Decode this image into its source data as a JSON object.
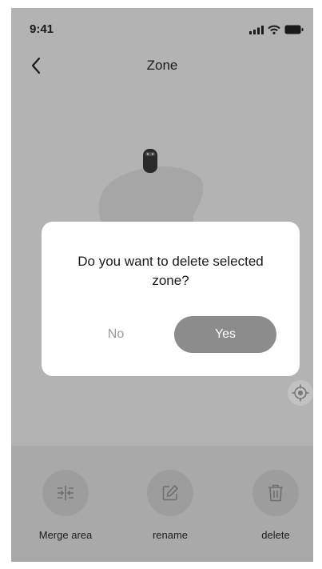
{
  "status_bar": {
    "time": "9:41",
    "icons": [
      "signal-icon",
      "wifi-icon",
      "battery-icon"
    ]
  },
  "header": {
    "back_icon": "chevron-left-icon",
    "title": "Zone"
  },
  "map": {
    "locate_icon": "locate-icon"
  },
  "dialog": {
    "message": "Do you want to delete selected zone?",
    "no_label": "No",
    "yes_label": "Yes"
  },
  "actions": [
    {
      "label": "Merge area",
      "icon": "merge-icon"
    },
    {
      "label": "rename",
      "icon": "edit-icon"
    },
    {
      "label": "delete",
      "icon": "trash-icon"
    }
  ],
  "colors": {
    "overlay_background": "#b3b3b3",
    "dialog_background": "#ffffff",
    "yes_button": "#8c8c8c",
    "no_text": "#9a9a9a"
  }
}
